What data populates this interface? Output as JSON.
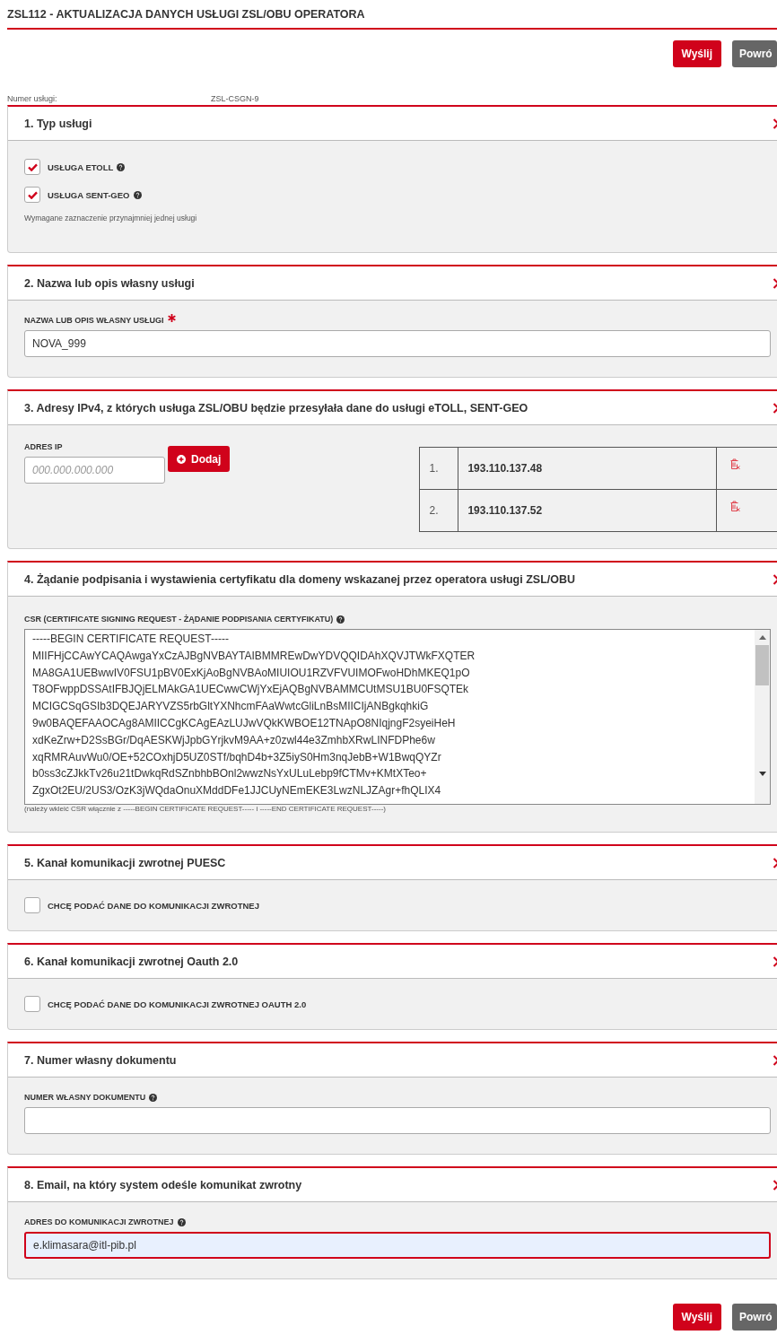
{
  "page": {
    "title": "ZSL112 - AKTUALIZACJA DANYCH USŁUGI ZSL/OBU OPERATORA"
  },
  "actions_top": [
    {
      "label": "Wyślij",
      "kind": "primary"
    },
    {
      "label": "Powró",
      "kind": "secondary"
    }
  ],
  "service_number": {
    "label": "Numer usługi:",
    "value": "ZSL-CSGN-9"
  },
  "sections": [
    {
      "kind": "checkboxes",
      "title": "1. Typ usługi",
      "items": [
        {
          "label": "USŁUGA ETOLL",
          "checked": true,
          "help": true
        },
        {
          "label": "USŁUGA SENT-GEO",
          "checked": true,
          "help": true
        }
      ],
      "note": "Wymagane zaznaczenie przynajmniej jednej usługi"
    },
    {
      "kind": "text_field",
      "title": "2. Nazwa lub opis własny usługi",
      "field": {
        "label": "NAZWA LUB OPIS WŁASNY USŁUGI",
        "required": true,
        "help": false,
        "value": "NOVA_999",
        "focused": false
      }
    },
    {
      "kind": "ip",
      "title": "3. Adresy IPv4, z których usługa ZSL/OBU będzie przesyłała dane do usługi eTOLL, SENT-GEO",
      "field": {
        "label": "ADRES IP",
        "placeholder": "000.000.000.000"
      },
      "add_button": "Dodaj",
      "rows": [
        {
          "number": "1.",
          "address": "193.110.137.48"
        },
        {
          "number": "2.",
          "address": "193.110.137.52"
        }
      ]
    },
    {
      "kind": "csr",
      "title": "4. Żądanie podpisania i wystawienia certyfikatu dla domeny wskazanej przez operatora usługi ZSL/OBU",
      "label": "CSR (CERTIFICATE SIGNING REQUEST - ŻĄDANIE PODPISANIA CERTYFIKATU)",
      "help": true,
      "value": "-----BEGIN CERTIFICATE REQUEST-----\nMIIFHjCCAwYCAQAwgaYxCzAJBgNVBAYTAIBMMREwDwYDVQQIDAhXQVJTWkFXQTER\nMA8GA1UEBwwIV0FSU1pBV0ExKjAoBgNVBAoMIUIOU1RZVFVUIMOFwoHDhMKEQ1pO\nT8OFwppDSSAtIFBJQjELMAkGA1UECwwCWjYxEjAQBgNVBAMMCUtMSU1BU0FSQTEk\nMCIGCSqGSIb3DQEJARYVZS5rbGltYXNhcmFAaWwtcGliLnBsMIICIjANBgkqhkiG\n9w0BAQEFAAOCAg8AMIICCgKCAgEAzLUJwVQkKWBOE12TNApO8NIqjngF2syeiHeH\nxdKeZrw+D2SsBGr/DqAESKWjJpbGYrjkvM9AA+z0zwl44e3ZmhbXRwLINFDPhe6w\nxqRMRAuvWu0/OE+52COxhjD5UZ0STf/bqhD4b+3Z5iyS0Hm3nqJebB+W1BwqQYZr\nb0ss3cZJkkTv26u21tDwkqRdSZnbhbBOnl2wwzNsYxULuLebp9fCTMv+KMtXTeo+\nZgxOt2EU/2US3/OzK3jWQdaOnuXMddDFe1JJCUyNEmEKE3LwzNLJZAgr+fhQLIX4",
      "hint": "(należy wkleić CSR włącznie z -----BEGIN CERTIFICATE REQUEST----- i -----END CERTIFICATE REQUEST-----)"
    },
    {
      "kind": "checkbox",
      "title": "5. Kanał komunikacji zwrotnej PUESC",
      "item": {
        "label": "CHCĘ PODAĆ DANE DO KOMUNIKACJI ZWROTNEJ",
        "checked": false
      }
    },
    {
      "kind": "checkbox",
      "title": "6. Kanał komunikacji zwrotnej Oauth 2.0",
      "item": {
        "label": "CHCĘ PODAĆ DANE DO KOMUNIKACJI ZWROTNEJ OAUTH 2.0",
        "checked": false
      }
    },
    {
      "kind": "text_field",
      "title": "7. Numer własny dokumentu",
      "field": {
        "label": "NUMER WŁASNY DOKUMENTU",
        "required": false,
        "help": true,
        "focused": false
      }
    },
    {
      "kind": "text_field",
      "title": "8. Email, na który system odeśle komunikat zwrotny",
      "field": {
        "label": "ADRES DO KOMUNIKACJI ZWROTNEJ",
        "required": false,
        "help": true,
        "value": "e.klimasara@itl-pib.pl",
        "focused": true
      }
    }
  ],
  "actions_bottom": [
    {
      "label": "Wyślij",
      "kind": "primary"
    },
    {
      "label": "Powró",
      "kind": "secondary"
    }
  ]
}
